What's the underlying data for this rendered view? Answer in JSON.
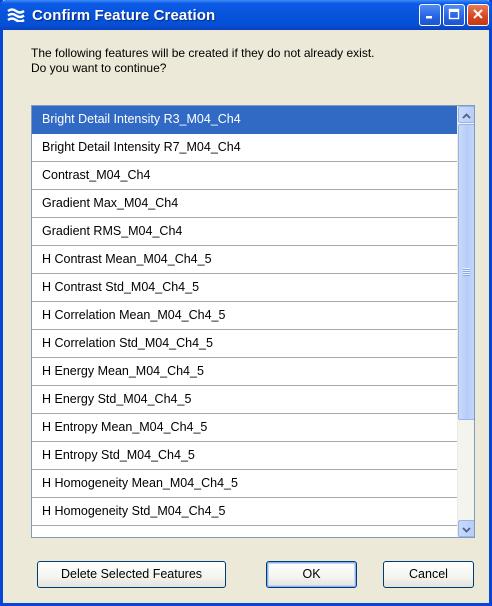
{
  "window": {
    "title": "Confirm Feature Creation",
    "title_icon": "dialog-app-icon",
    "controls": [
      "minimize-icon",
      "maximize-icon",
      "close-icon"
    ]
  },
  "message": {
    "line1": "The following features will be created if they do not already exist.",
    "line2": "Do you want to continue?"
  },
  "features": [
    "Bright Detail Intensity R3_M04_Ch4",
    "Bright Detail Intensity R7_M04_Ch4",
    "Contrast_M04_Ch4",
    "Gradient Max_M04_Ch4",
    "Gradient RMS_M04_Ch4",
    "H Contrast Mean_M04_Ch4_5",
    "H Contrast Std_M04_Ch4_5",
    "H Correlation Mean_M04_Ch4_5",
    "H Correlation Std_M04_Ch4_5",
    "H Energy Mean_M04_Ch4_5",
    "H Energy Std_M04_Ch4_5",
    "H Entropy Mean_M04_Ch4_5",
    "H Entropy Std_M04_Ch4_5",
    "H Homogeneity Mean_M04_Ch4_5",
    "H Homogeneity Std_M04_Ch4_5"
  ],
  "selected_index": 0,
  "buttons": {
    "delete": "Delete Selected Features",
    "ok": "OK",
    "cancel": "Cancel"
  },
  "colors": {
    "titlebar": "#0753d9",
    "selection": "#316ac5",
    "dialog_bg": "#ece9d8"
  }
}
